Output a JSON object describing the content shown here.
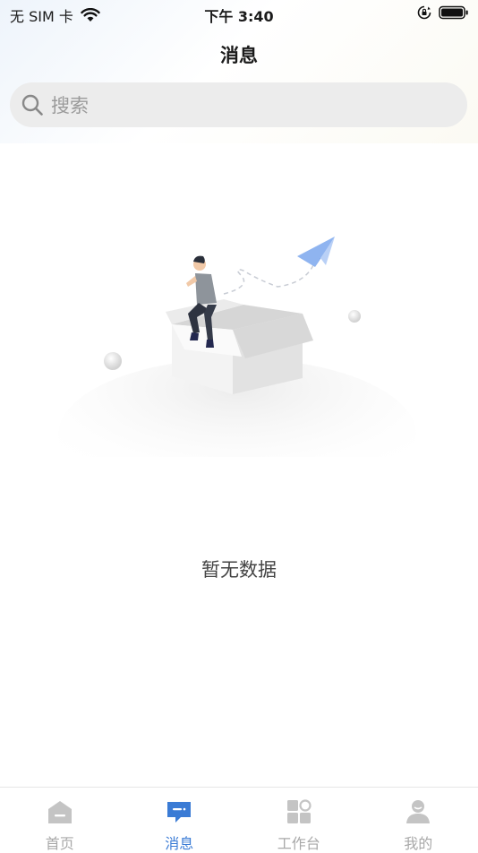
{
  "status_bar": {
    "carrier": "无 SIM 卡",
    "time": "下午 3:40"
  },
  "header": {
    "title": "消息"
  },
  "search": {
    "placeholder": "搜索"
  },
  "empty_state": {
    "text": "暂无数据"
  },
  "tab_bar": {
    "active_color": "#3a7bd5",
    "inactive_color": "#a8a8a8",
    "items": [
      {
        "label": "首页",
        "icon": "home-icon",
        "active": false
      },
      {
        "label": "消息",
        "icon": "message-icon",
        "active": true
      },
      {
        "label": "工作台",
        "icon": "workbench-icon",
        "active": false
      },
      {
        "label": "我的",
        "icon": "profile-icon",
        "active": false
      }
    ]
  }
}
